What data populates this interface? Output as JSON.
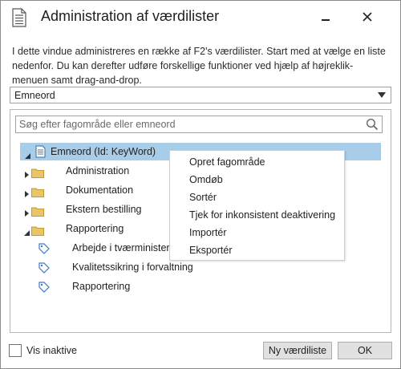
{
  "window": {
    "title": "Administration af værdilister",
    "icons": {
      "app": "document-list-icon",
      "minimize": "minimize-icon",
      "close": "close-icon"
    }
  },
  "description": "I dette vindue administreres en række af F2's værdilister. Start med at vælge en liste nedenfor. Du kan derefter udføre forskellige funktioner ved hjælp af højreklik-menuen samt drag-and-drop.",
  "list_select": {
    "value": "Emneord"
  },
  "search": {
    "placeholder": "Søg efter fagområde eller emneord",
    "value": ""
  },
  "tree": {
    "root": {
      "label": "Emneord (Id: KeyWord)",
      "expanded": true,
      "selected": true
    },
    "folders": [
      {
        "label": "Administration",
        "expanded": false
      },
      {
        "label": "Dokumentation",
        "expanded": false
      },
      {
        "label": "Ekstern bestilling",
        "expanded": false
      },
      {
        "label": "Rapportering",
        "expanded": true
      }
    ],
    "leaves": [
      {
        "label": "Arbejde i tværministerie"
      },
      {
        "label": "Kvalitetssikring i forvaltning"
      },
      {
        "label": "Rapportering"
      }
    ]
  },
  "context_menu": {
    "items": [
      {
        "label": "Opret fagområde"
      },
      {
        "label": "Omdøb"
      },
      {
        "label": "Sortér"
      },
      {
        "label": "Tjek for inkonsistent deaktivering"
      },
      {
        "label": "Importér"
      },
      {
        "label": "Eksportér"
      }
    ]
  },
  "footer": {
    "show_inactive_label": "Vis inaktive",
    "show_inactive_checked": false,
    "new_list_label": "Ny værdiliste",
    "ok_label": "OK"
  },
  "colors": {
    "selection": "#a7cde8",
    "folder": "#e8c46a",
    "tag": "#3c78c8"
  }
}
